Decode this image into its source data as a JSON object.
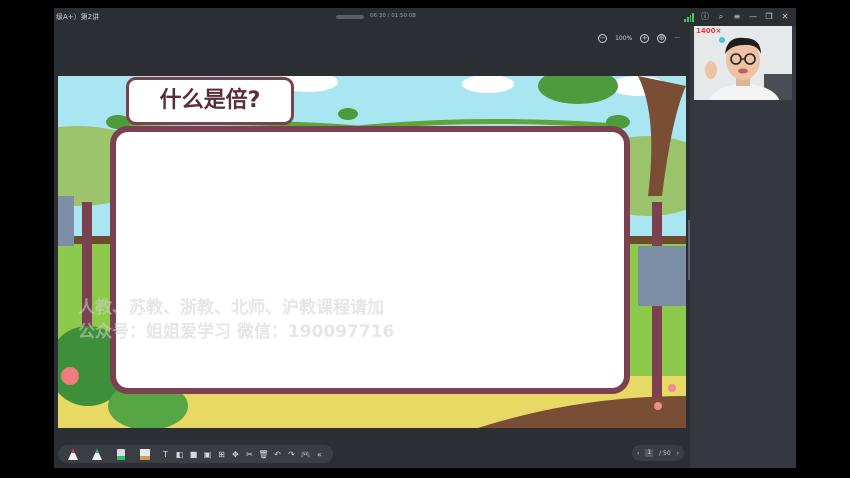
{
  "window": {
    "title": "级A+）第2讲",
    "time": "06:30 / 01:50:08"
  },
  "zoom": {
    "minus_icon": "zoom-out-icon",
    "level": "100%",
    "plus_icon": "zoom-in-icon"
  },
  "slide": {
    "title": "什么是倍?",
    "watermark_line1": "人教、苏教、浙教、北师、沪教课程请加",
    "watermark_line2": "公众号：姐姐爱学习 微信：190097716"
  },
  "camera": {
    "label": "1400×",
    "name": "teacher-webcam"
  },
  "pager": {
    "current": "1",
    "total": "/ 50",
    "prev": "‹",
    "next": "›"
  },
  "colors": {
    "frame": "#7b4150",
    "background": "#2b2e33",
    "signal": "#3fcf58",
    "sky": "#a9e6f2",
    "grass": "#8dc94a"
  }
}
